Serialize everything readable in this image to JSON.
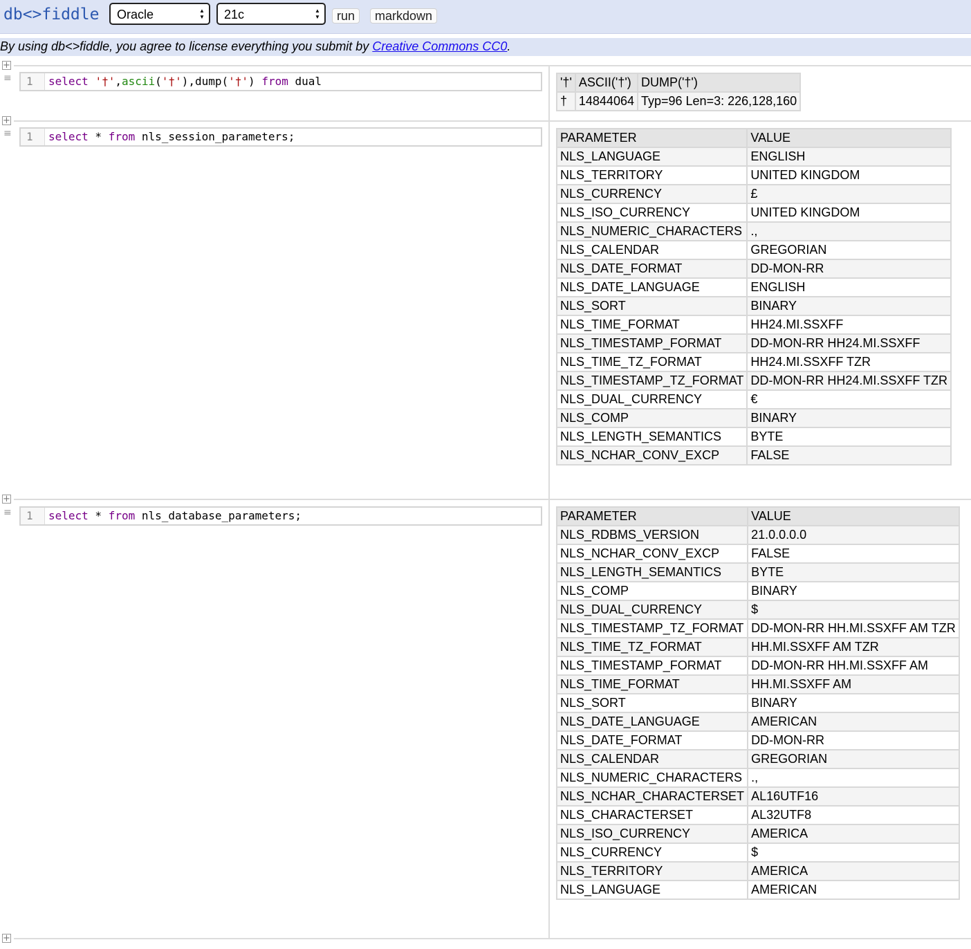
{
  "header": {
    "logo": "db<>fiddle",
    "db_select": "Oracle",
    "version_select": "21c",
    "run_label": "run",
    "markdown_label": "markdown"
  },
  "license": {
    "prefix": "By using db<>fiddle, you agree to license everything you submit by ",
    "link": "Creative Commons CC0",
    "suffix": "."
  },
  "gutter": {
    "plus_icon": "+",
    "grip_icon": "≡"
  },
  "batches": [
    {
      "line_number": "1",
      "code_tokens": [
        {
          "t": "select",
          "c": "kw"
        },
        {
          "t": " ",
          "c": ""
        },
        {
          "t": "'†'",
          "c": "st"
        },
        {
          "t": ",",
          "c": ""
        },
        {
          "t": "ascii",
          "c": "fn"
        },
        {
          "t": "(",
          "c": ""
        },
        {
          "t": "'†'",
          "c": "st"
        },
        {
          "t": "),dump(",
          "c": ""
        },
        {
          "t": "'†'",
          "c": "st"
        },
        {
          "t": ") ",
          "c": ""
        },
        {
          "t": "from",
          "c": "kw"
        },
        {
          "t": " dual",
          "c": ""
        }
      ],
      "result": {
        "headers": [
          "'†'",
          "ASCII('†')",
          "DUMP('†')"
        ],
        "rows": [
          [
            "†",
            "14844064",
            "Typ=96 Len=3: 226,128,160"
          ]
        ]
      }
    },
    {
      "line_number": "1",
      "code_tokens": [
        {
          "t": "select",
          "c": "kw"
        },
        {
          "t": " * ",
          "c": ""
        },
        {
          "t": "from",
          "c": "kw"
        },
        {
          "t": " nls_session_parameters;",
          "c": ""
        }
      ],
      "result": {
        "headers": [
          "PARAMETER",
          "VALUE"
        ],
        "rows": [
          [
            "NLS_LANGUAGE",
            "ENGLISH"
          ],
          [
            "NLS_TERRITORY",
            "UNITED KINGDOM"
          ],
          [
            "NLS_CURRENCY",
            "£"
          ],
          [
            "NLS_ISO_CURRENCY",
            "UNITED KINGDOM"
          ],
          [
            "NLS_NUMERIC_CHARACTERS",
            ".,"
          ],
          [
            "NLS_CALENDAR",
            "GREGORIAN"
          ],
          [
            "NLS_DATE_FORMAT",
            "DD-MON-RR"
          ],
          [
            "NLS_DATE_LANGUAGE",
            "ENGLISH"
          ],
          [
            "NLS_SORT",
            "BINARY"
          ],
          [
            "NLS_TIME_FORMAT",
            "HH24.MI.SSXFF"
          ],
          [
            "NLS_TIMESTAMP_FORMAT",
            "DD-MON-RR HH24.MI.SSXFF"
          ],
          [
            "NLS_TIME_TZ_FORMAT",
            "HH24.MI.SSXFF TZR"
          ],
          [
            "NLS_TIMESTAMP_TZ_FORMAT",
            "DD-MON-RR HH24.MI.SSXFF TZR"
          ],
          [
            "NLS_DUAL_CURRENCY",
            "€"
          ],
          [
            "NLS_COMP",
            "BINARY"
          ],
          [
            "NLS_LENGTH_SEMANTICS",
            "BYTE"
          ],
          [
            "NLS_NCHAR_CONV_EXCP",
            "FALSE"
          ]
        ]
      }
    },
    {
      "line_number": "1",
      "code_tokens": [
        {
          "t": "select",
          "c": "kw"
        },
        {
          "t": " * ",
          "c": ""
        },
        {
          "t": "from",
          "c": "kw"
        },
        {
          "t": " nls_database_parameters;",
          "c": ""
        }
      ],
      "result": {
        "headers": [
          "PARAMETER",
          "VALUE"
        ],
        "rows": [
          [
            "NLS_RDBMS_VERSION",
            "21.0.0.0.0"
          ],
          [
            "NLS_NCHAR_CONV_EXCP",
            "FALSE"
          ],
          [
            "NLS_LENGTH_SEMANTICS",
            "BYTE"
          ],
          [
            "NLS_COMP",
            "BINARY"
          ],
          [
            "NLS_DUAL_CURRENCY",
            "$"
          ],
          [
            "NLS_TIMESTAMP_TZ_FORMAT",
            "DD-MON-RR HH.MI.SSXFF AM TZR"
          ],
          [
            "NLS_TIME_TZ_FORMAT",
            "HH.MI.SSXFF AM TZR"
          ],
          [
            "NLS_TIMESTAMP_FORMAT",
            "DD-MON-RR HH.MI.SSXFF AM"
          ],
          [
            "NLS_TIME_FORMAT",
            "HH.MI.SSXFF AM"
          ],
          [
            "NLS_SORT",
            "BINARY"
          ],
          [
            "NLS_DATE_LANGUAGE",
            "AMERICAN"
          ],
          [
            "NLS_DATE_FORMAT",
            "DD-MON-RR"
          ],
          [
            "NLS_CALENDAR",
            "GREGORIAN"
          ],
          [
            "NLS_NUMERIC_CHARACTERS",
            ".,"
          ],
          [
            "NLS_NCHAR_CHARACTERSET",
            "AL16UTF16"
          ],
          [
            "NLS_CHARACTERSET",
            "AL32UTF8"
          ],
          [
            "NLS_ISO_CURRENCY",
            "AMERICA"
          ],
          [
            "NLS_CURRENCY",
            "$"
          ],
          [
            "NLS_TERRITORY",
            "AMERICA"
          ],
          [
            "NLS_LANGUAGE",
            "AMERICAN"
          ]
        ]
      }
    }
  ]
}
